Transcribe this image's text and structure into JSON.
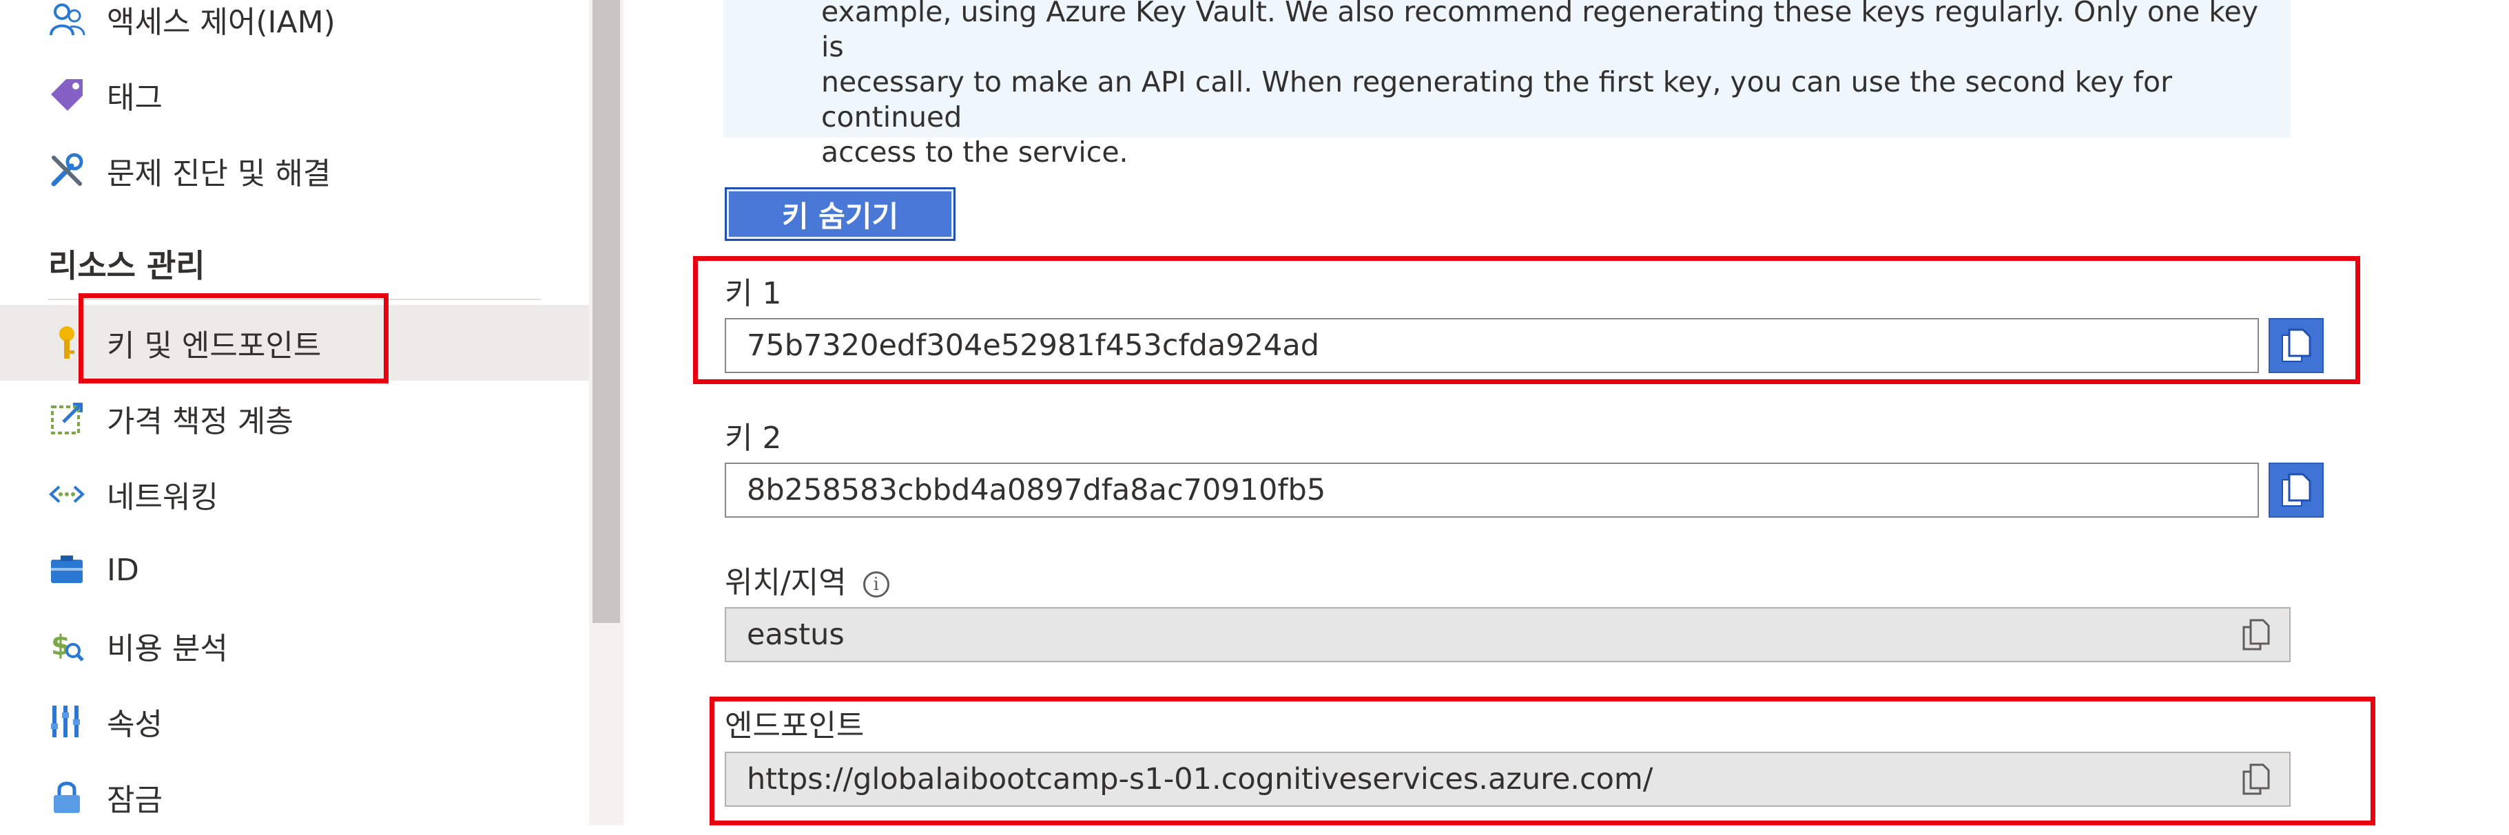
{
  "sidebar": {
    "items_top": [
      {
        "label": "액세스 제어(IAM)",
        "icon": "people-icon"
      },
      {
        "label": "태그",
        "icon": "tag-icon"
      },
      {
        "label": "문제 진단 및 해결",
        "icon": "wrench-icon"
      }
    ],
    "section_title": "리소스 관리",
    "items": [
      {
        "label": "키 및 엔드포인트",
        "icon": "key-icon",
        "selected": true
      },
      {
        "label": "가격 책정 계층",
        "icon": "edit-icon"
      },
      {
        "label": "네트워킹",
        "icon": "network-icon"
      },
      {
        "label": "ID",
        "icon": "identity-icon"
      },
      {
        "label": "비용 분석",
        "icon": "cost-icon"
      },
      {
        "label": "속성",
        "icon": "properties-icon"
      },
      {
        "label": "잠금",
        "icon": "lock-icon"
      }
    ]
  },
  "info": {
    "line1": "example, using Azure Key Vault. We also recommend regenerating these keys regularly. Only one key is",
    "line2": "necessary to make an API call. When regenerating the first key, you can use the second key for continued",
    "line3": "access to the service."
  },
  "hide_keys_label": "키 숨기기",
  "key1": {
    "label": "키 1",
    "value": "75b7320edf304e52981f453cfda924ad"
  },
  "key2": {
    "label": "키 2",
    "value": "8b258583cbbd4a0897dfa8ac70910fb5"
  },
  "location": {
    "label": "위치/지역",
    "value": "eastus"
  },
  "endpoint": {
    "label": "엔드포인트",
    "value": "https://globalaibootcamp-s1-01.cognitiveservices.azure.com/"
  },
  "colors": {
    "highlight": "#e8000e",
    "accent": "#3f74d4",
    "selected_bg": "#edebe9"
  }
}
